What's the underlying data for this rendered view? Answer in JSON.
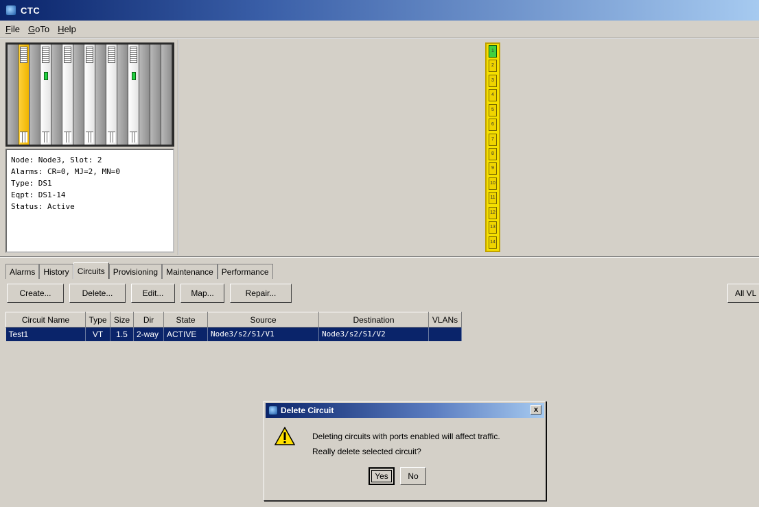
{
  "window": {
    "title": "CTC"
  },
  "menu": [
    "File",
    "GoTo",
    "Help"
  ],
  "node_info": {
    "lines": [
      "Node: Node3, Slot: 2",
      "Alarms: CR=0, MJ=2, MN=0",
      "Type: DS1",
      "Eqpt: DS1-14",
      "Status: Active"
    ]
  },
  "ports": [
    "1",
    "2",
    "3",
    "4",
    "5",
    "6",
    "7",
    "8",
    "9",
    "10",
    "11",
    "12",
    "13",
    "14"
  ],
  "tabs": [
    "Alarms",
    "History",
    "Circuits",
    "Provisioning",
    "Maintenance",
    "Performance"
  ],
  "active_tab": "Circuits",
  "toolbar": {
    "create": "Create...",
    "delete": "Delete...",
    "edit": "Edit...",
    "map": "Map...",
    "repair": "Repair...",
    "all_vlans": "All VL"
  },
  "table": {
    "columns": [
      "Circuit Name",
      "Type",
      "Size",
      "Dir",
      "State",
      "Source",
      "Destination",
      "VLANs"
    ],
    "rows": [
      [
        "Test1",
        "VT",
        "1.5",
        "2-way",
        "ACTIVE",
        "Node3/s2/S1/V1",
        "Node3/s2/S1/V2",
        ""
      ]
    ]
  },
  "dialog": {
    "title": "Delete Circuit",
    "close": "x",
    "message1": "Deleting circuits with ports enabled will affect traffic.",
    "message2": "Really delete selected circuit?",
    "yes": "Yes",
    "no": "No"
  },
  "colors": {
    "title_bar": "#0a246a",
    "selected_slot": "#f0b400",
    "port_strip": "#f5e000",
    "selection": "#0a246a"
  }
}
